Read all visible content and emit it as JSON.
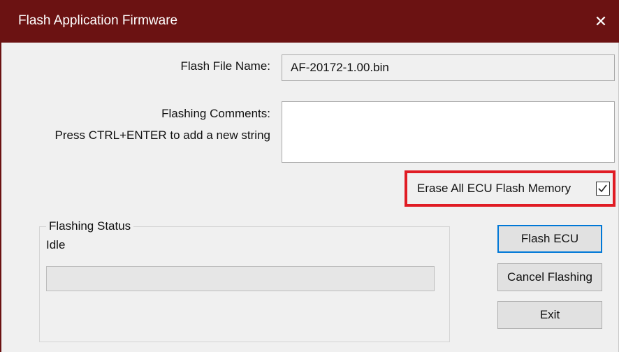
{
  "window": {
    "title": "Flash Application Firmware",
    "close_glyph": "✕",
    "titlebar_color": "#6b1212",
    "icons": {
      "close": "close-icon",
      "check": "check-icon"
    }
  },
  "form": {
    "file_name_label": "Flash File Name:",
    "file_name_value": "AF-20172-1.00.bin",
    "comments_label": "Flashing Comments:",
    "comments_hint": "Press CTRL+ENTER to add a new string",
    "comments_value": "",
    "erase_label": "Erase All ECU Flash Memory",
    "erase_checked": true,
    "highlight_color": "#e01c24"
  },
  "status": {
    "group_label": "Flashing Status",
    "state": "Idle",
    "progress": 0
  },
  "buttons": {
    "flash": "Flash ECU",
    "cancel": "Cancel Flashing",
    "exit": "Exit"
  }
}
